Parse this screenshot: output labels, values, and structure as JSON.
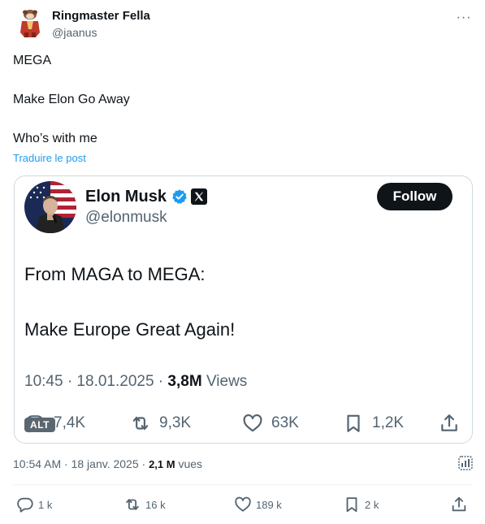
{
  "author": {
    "name": "Ringmaster Fella",
    "handle": "@jaanus"
  },
  "post": {
    "lines": [
      "MEGA",
      "Make Elon Go Away",
      "Who’s with me"
    ],
    "translate_label": "Traduire le post"
  },
  "quote": {
    "name": "Elon Musk",
    "handle": "@elonmusk",
    "follow_label": "Follow",
    "text_line1": "From MAGA to MEGA:",
    "text_line2": "Make Europe Great Again!",
    "time_date": "10:45 · 18.01.2025 · ",
    "views_count": "3,8M",
    "views_label": " Views",
    "alt_label": "ALT",
    "replies": "7,4K",
    "reposts": "9,3K",
    "likes": "63K",
    "bookmarks": "1,2K"
  },
  "meta": {
    "time_date": "10:54 AM · 18 janv. 2025 · ",
    "views_count": "2,1 M",
    "views_label": " vues"
  },
  "stats": {
    "replies": "1 k",
    "reposts": "16 k",
    "likes": "189 k",
    "bookmarks": "2 k"
  },
  "colors": {
    "accent": "#1d9bf0",
    "text": "#0f1419",
    "secondary": "#536471",
    "border": "#cfd9de",
    "verified": "#1d9bf0"
  }
}
